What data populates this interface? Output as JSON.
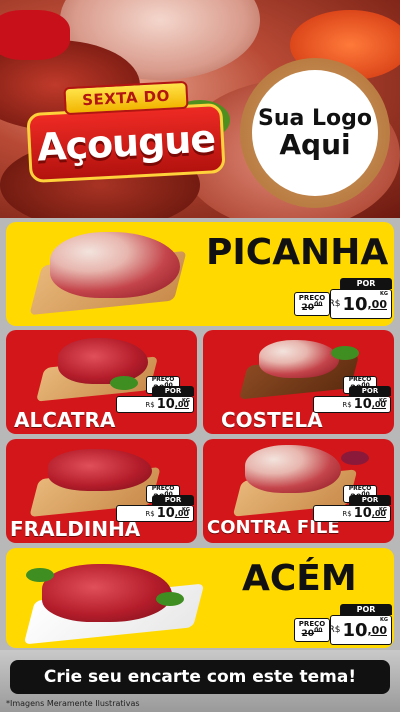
{
  "header": {
    "badge_top": "SEXTA DO",
    "badge_main": "Açougue",
    "logo_line1": "Sua Logo",
    "logo_line2": "Aqui"
  },
  "tag_labels": {
    "por": "POR",
    "preco": "PREÇO",
    "currency": "R$",
    "unit": "KG"
  },
  "products": [
    {
      "name": "PICANHA",
      "old_price_int": "20",
      "old_price_dec": "00",
      "price_int": "10",
      "price_dec": ",00"
    },
    {
      "name": "ALCATRA",
      "old_price_int": "20",
      "old_price_dec": "00",
      "price_int": "10",
      "price_dec": ",00"
    },
    {
      "name": "COSTELA",
      "old_price_int": "20",
      "old_price_dec": "00",
      "price_int": "10",
      "price_dec": ",00"
    },
    {
      "name": "FRALDINHA",
      "old_price_int": "20",
      "old_price_dec": "00",
      "price_int": "10",
      "price_dec": ",00"
    },
    {
      "name": "CONTRA FILÉ",
      "old_price_int": "20",
      "old_price_dec": "00",
      "price_int": "10",
      "price_dec": ",00"
    },
    {
      "name": "ACÉM",
      "old_price_int": "20",
      "old_price_dec": "00",
      "price_int": "10",
      "price_dec": ",00"
    }
  ],
  "footer": {
    "cta": "Crie seu encarte com este tema!",
    "disclaimer": "*Imagens Meramente Ilustrativas"
  },
  "colors": {
    "yellow": "#ffd900",
    "red": "#d31619",
    "black": "#111111"
  }
}
